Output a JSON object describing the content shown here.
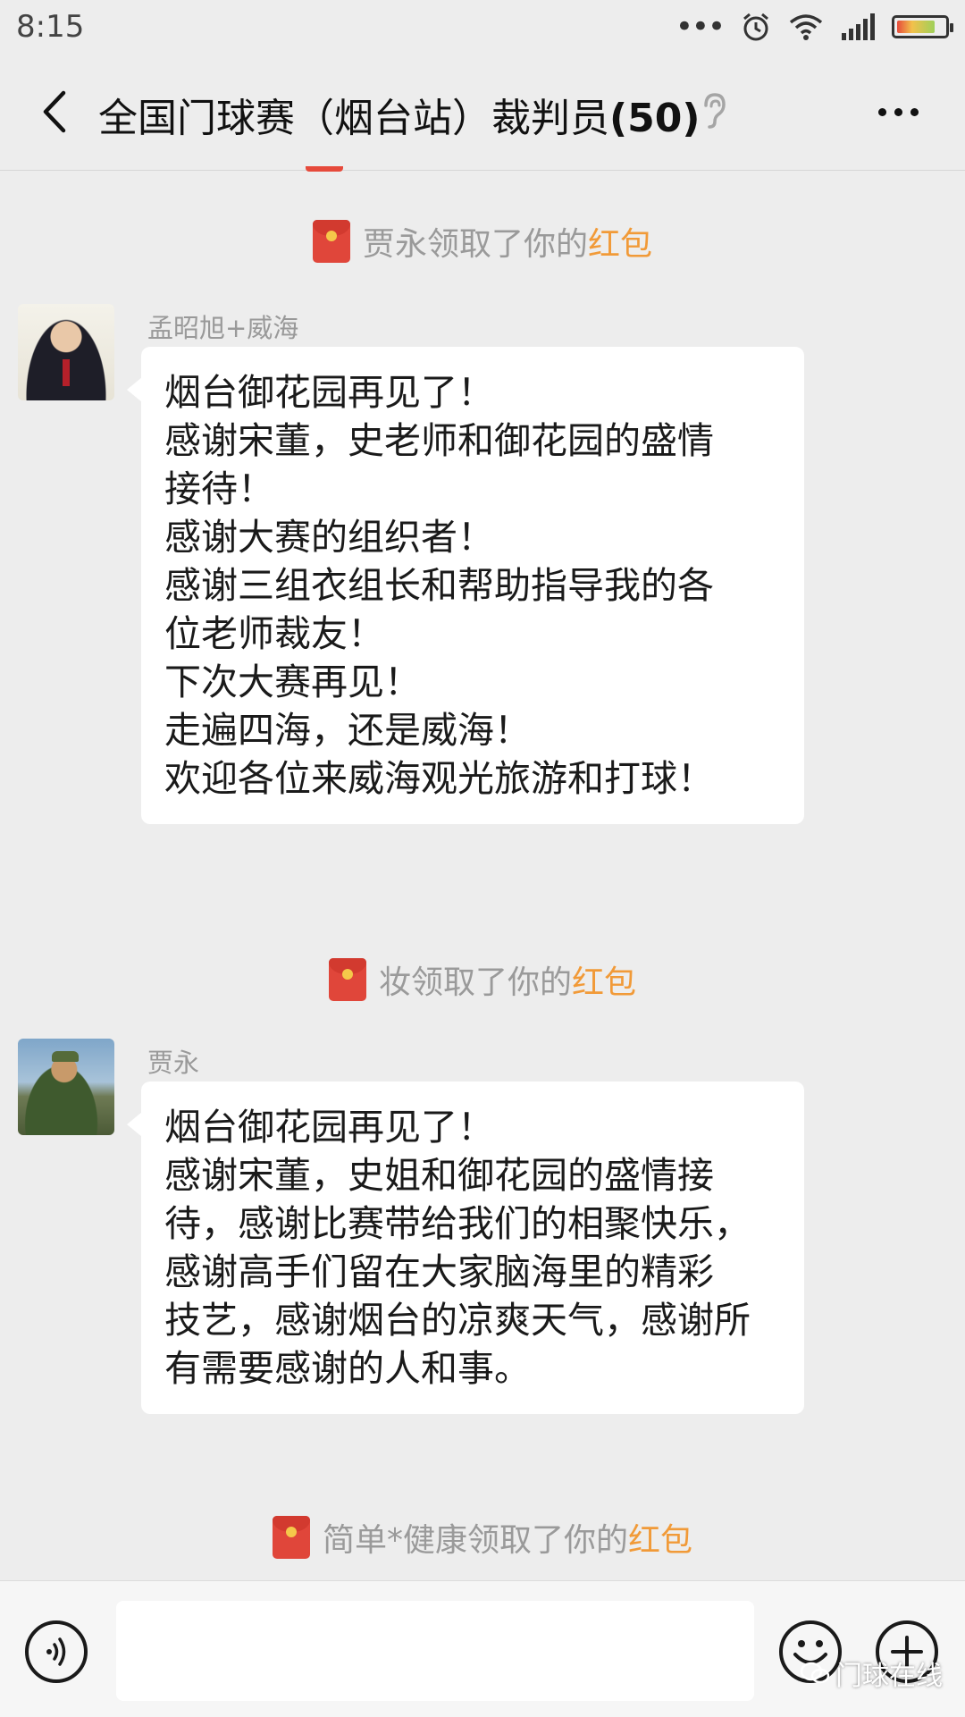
{
  "status_bar": {
    "time": "8:15",
    "icons": [
      "more-dots-icon",
      "alarm-icon",
      "wifi-icon",
      "signal-icon",
      "battery-icon"
    ]
  },
  "header": {
    "title_main": "全国门球赛（烟台站）裁判员",
    "title_count": "(50)",
    "back_icon": "chevron-left-icon",
    "muted_icon": "ear-icon",
    "more_icon": "more-horizontal-icon"
  },
  "messages": {
    "notice1": {
      "text": "贾永领取了你的",
      "link": "红包"
    },
    "msg1": {
      "sender": "孟昭旭+威海",
      "lines": [
        "烟台御花园再见了！",
        "感谢宋董，史老师和御花园的盛情",
        "接待！",
        "感谢大赛的组织者！",
        "感谢三组衣组长和帮助指导我的各",
        "位老师裁友！",
        "下次大赛再见！",
        "走遍四海，还是威海！",
        "欢迎各位来威海观光旅游和打球！"
      ]
    },
    "notice2": {
      "text": "妆领取了你的",
      "link": "红包"
    },
    "msg2": {
      "sender": "贾永",
      "lines": [
        "烟台御花园再见了！",
        "感谢宋董，史姐和御花园的盛情接",
        "待，感谢比赛带给我们的相聚快乐，",
        "感谢高手们留在大家脑海里的精彩",
        "技艺，感谢烟台的凉爽天气，感谢所",
        "有需要感谢的人和事。"
      ]
    },
    "notice3": {
      "text": "简单*健康领取了你的",
      "link": "红包"
    }
  },
  "input_bar": {
    "voice_icon": "voice-icon",
    "input_value": "",
    "emoji_icon": "emoji-icon",
    "plus_icon": "plus-icon"
  },
  "watermark": {
    "text": "门球在线"
  },
  "colors": {
    "background": "#ededed",
    "bubble": "#ffffff",
    "red_packet": "#e0463a",
    "link_orange": "#f19a38",
    "notice_gray": "#9a9a9a"
  }
}
